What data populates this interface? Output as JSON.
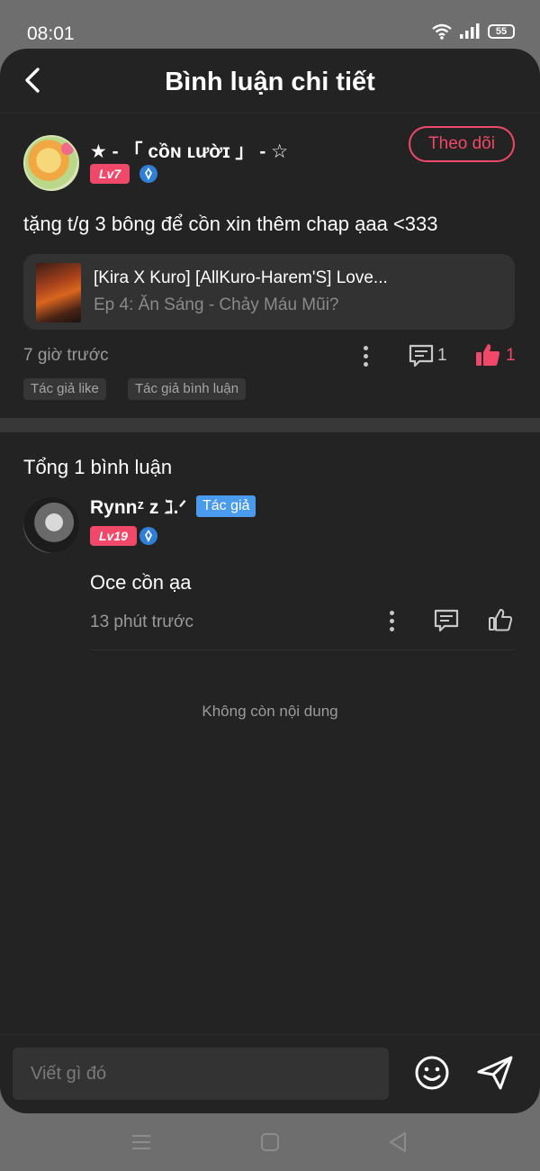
{
  "status_bar": {
    "time": "08:01",
    "battery": "55",
    "icons": [
      "wifi-icon",
      "signal-icon",
      "battery-icon"
    ]
  },
  "header": {
    "title": "Bình luận chi tiết",
    "back_icon": "chevron-left-icon"
  },
  "post": {
    "username": "★ - 「 ᴄồɴ ʟườɪ 」 - ☆",
    "level": "Lv7",
    "follow_label": "Theo dõi",
    "text": "tặng t/g 3 bông để cồn xin thêm chap ạaa <333",
    "story": {
      "title": "[Kira X Kuro] [AllKuro-Harem'S] Love...",
      "episode": "Ep 4: Ăn Sáng - Chảy Máu Mũi?"
    },
    "time": "7 giờ trước",
    "comment_count": "1",
    "like_count": "1",
    "tags": [
      "Tác giả like",
      "Tác giả bình luận"
    ]
  },
  "replies": {
    "total": "Tổng 1 bình luận",
    "items": [
      {
        "username": "Rynnᶻ z ℷ.ᐟ",
        "author_badge": "Tác giả",
        "level": "Lv19",
        "text": "Oce cồn ạa",
        "time": "13 phút trước"
      }
    ],
    "end_text": "Không còn nội dung"
  },
  "input": {
    "placeholder": "Viết gì đó"
  },
  "colors": {
    "accent": "#f04868",
    "author_blue": "#4a9bee",
    "background": "#232323",
    "verify_blue": "#2f7fd6"
  }
}
